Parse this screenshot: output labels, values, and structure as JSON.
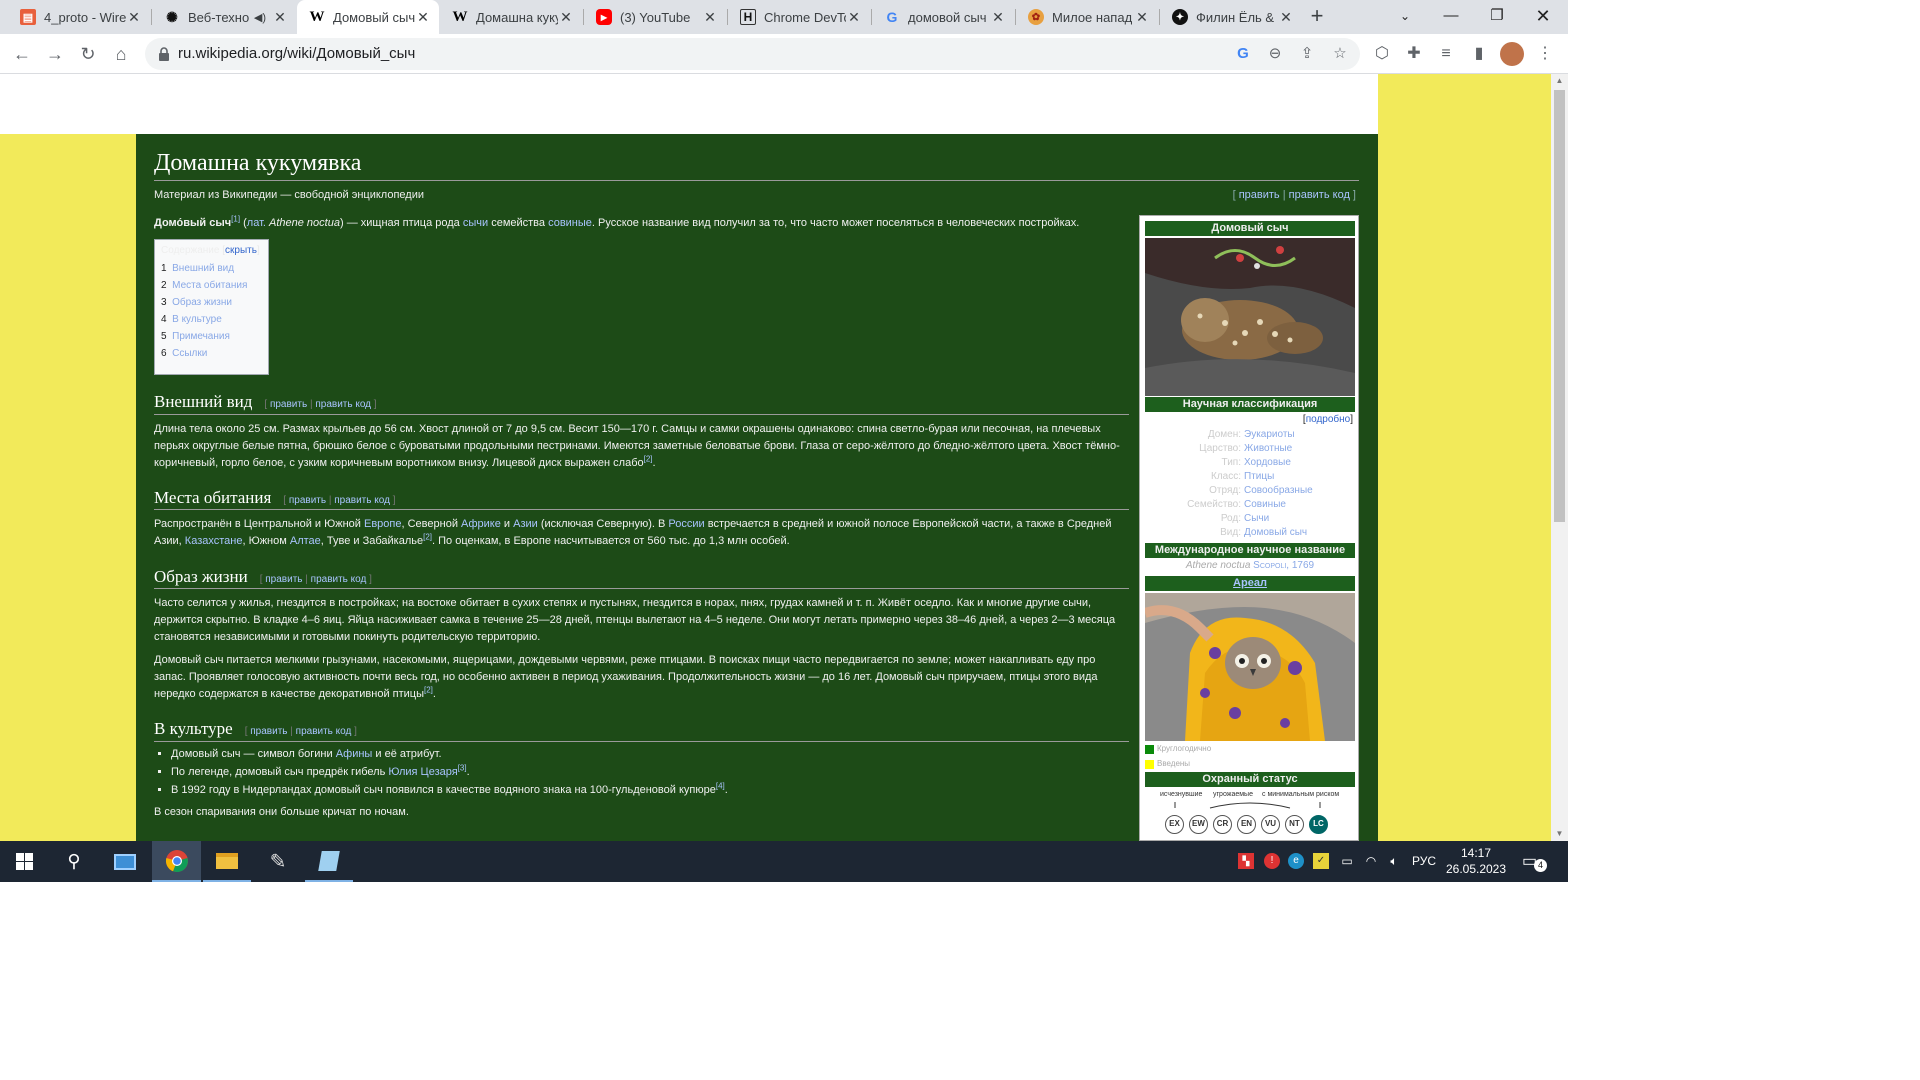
{
  "browser": {
    "tabs": [
      {
        "title": "4_proto - Wire",
        "icon": "figma-file-icon"
      },
      {
        "title": "Веб-техно",
        "icon": "openai-icon"
      },
      {
        "title": "Домовый сыч",
        "icon": "wikipedia-icon",
        "active": true
      },
      {
        "title": "Домашна кукум",
        "icon": "wikipedia-icon"
      },
      {
        "title": "(3) YouTube",
        "icon": "youtube-icon"
      },
      {
        "title": "Chrome DevTo",
        "icon": "habr-icon"
      },
      {
        "title": "домовой сыч",
        "icon": "google-icon"
      },
      {
        "title": "Милое напад",
        "icon": "pikabu-icon"
      },
      {
        "title": "Филин Ёль &",
        "icon": "dzen-icon"
      }
    ],
    "url": "ru.wikipedia.org/wiki/Домовый_сыч"
  },
  "page": {
    "title": "Домашна кукумявка",
    "tagline": "Материал из Википедии — свободной энциклопедии",
    "edit": "править",
    "edit_code": "править код",
    "lead": {
      "term": "Домо́вый сыч",
      "ref1": "[1]",
      "lat": "лат.",
      "latin_name": "Athene noctua",
      "text1": ") — хищная птица рода ",
      "link_genus": "сычи",
      "text2": " семейства ",
      "link_family": "совиные",
      "text3": ". Русское название вид получил за то, что часто может поселяться в человеческих постройках."
    },
    "toc": {
      "title": "Содержание",
      "hide": "скрыть",
      "items": [
        {
          "num": "1",
          "label": "Внешний вид"
        },
        {
          "num": "2",
          "label": "Места обитания"
        },
        {
          "num": "3",
          "label": "Образ жизни"
        },
        {
          "num": "4",
          "label": "В культуре"
        },
        {
          "num": "5",
          "label": "Примечания"
        },
        {
          "num": "6",
          "label": "Ссылки"
        }
      ]
    },
    "sections": {
      "appearance": {
        "heading": "Внешний вид",
        "text": "Длина тела около 25 см. Размах крыльев до 56 см. Хвост длиной от 7 до 9,5 см. Весит 150—170 г. Самцы и самки окрашены одинаково: спина светло-бурая или песочная, на плечевых перьях округлые белые пятна, брюшко белое с буроватыми продольными пестринами. Имеются заметные беловатые брови. Глаза от серо-жёлтого до бледно-жёлтого цвета. Хвост тёмно-коричневый, горло белое, с узким коричневым воротником внизу. Лицевой диск выражен слабо",
        "ref": "[2]"
      },
      "habitat": {
        "heading": "Места обитания",
        "t1": "Распространён в Центральной и Южной ",
        "l1": "Европе",
        "t2": ", Северной ",
        "l2": "Африке",
        "t3": " и ",
        "l3": "Азии",
        "t4": " (исключая Северную). В ",
        "l4": "России",
        "t5": " встречается в средней и южной полосе Европейской части, а также в Средней Азии, ",
        "l5": "Казахстане",
        "t6": ", Южном ",
        "l6": "Алтае",
        "t7": ", Туве и Забайкалье",
        "ref": "[2]",
        "t8": ". По оценкам, в Европе насчитывается от 560 тыс. до 1,3 млн особей."
      },
      "lifestyle": {
        "heading": "Образ жизни",
        "p1": "Часто селится у жилья, гнездится в постройках; на востоке обитает в сухих степях и пустынях, гнездится в норах, пнях, грудах камней и т. п. Живёт оседло. Как и многие другие сычи, держится скрытно. В кладке 4–6 яиц. Яйца насиживает самка в течение 25—28 дней, птенцы вылетают на 4–5 неделе. Они могут летать примерно через 38–46 дней, а через 2—3 месяца становятся независимыми и готовыми покинуть родительскую территорию.",
        "p2": "Домовый сыч питается мелкими грызунами, насекомыми, ящерицами, дождевыми червями, реже птицами. В поисках пищи часто передвигается по земле; может накапливать еду про запас. Проявляет голосовую активность почти весь год, но особенно активен в период ухаживания. Продолжительность жизни — до 16 лет. Домовый сыч приручаем, птицы этого вида нередко содержатся в качестве декоративной птицы",
        "ref": "[2]"
      },
      "culture": {
        "heading": "В культуре",
        "li1a": "Домовый сыч — символ богини ",
        "li1link": "Афины",
        "li1b": " и её атрибут.",
        "li2a": "По легенде, домовый сыч предрёк гибель ",
        "li2link": "Юлия Цезаря",
        "li2ref": "[3]",
        "li2b": ".",
        "li3a": "В 1992 году в Нидерландах домовый сыч появился в качестве водяного знака на 100-гульденовой купюре",
        "li3ref": "[4]",
        "li3b": ".",
        "after": "В сезон спаривания они больше кричат по ночам."
      }
    },
    "infobox": {
      "title": "Домовый сыч",
      "sci_class": "Научная классификация",
      "detail": "подробно",
      "rows": [
        {
          "k": "Домен:",
          "v": "Эукариоты"
        },
        {
          "k": "Царство:",
          "v": "Животные"
        },
        {
          "k": "Тип:",
          "v": "Хордовые"
        },
        {
          "k": "Класс:",
          "v": "Птицы"
        },
        {
          "k": "Отряд:",
          "v": "Совообразные"
        },
        {
          "k": "Семейство:",
          "v": "Совиные"
        },
        {
          "k": "Род:",
          "v": "Сычи"
        },
        {
          "k": "Вид:",
          "v": "Домовый сыч"
        }
      ],
      "intl_name": "Международное научное название",
      "binomial": "Athene noctua",
      "author": "Scopoli",
      "year": ", 1769",
      "range": "Ареал",
      "legend1": "Круглогодично",
      "legend2": "Введены",
      "status": "Охранный статус",
      "status_extinct": "исчезнувшие",
      "status_threatened": "угрожаемые",
      "status_lc_label": "с минимальным риском",
      "iucn": [
        "EX",
        "EW",
        "CR",
        "EN",
        "VU",
        "NT",
        "LC"
      ]
    }
  },
  "taskbar": {
    "lang": "РУС",
    "time": "14:17",
    "date": "26.05.2023",
    "notifications": "4"
  }
}
